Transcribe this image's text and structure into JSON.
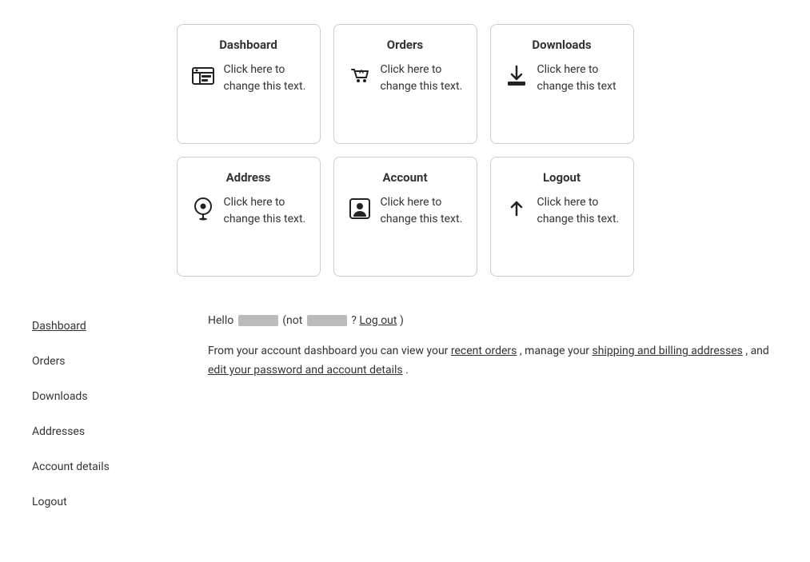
{
  "cards": [
    {
      "id": "dashboard",
      "title": "Dashboard",
      "text": "Click here to change this text.",
      "icon": "dashboard"
    },
    {
      "id": "orders",
      "title": "Orders",
      "text": "Click here to change this text.",
      "icon": "orders"
    },
    {
      "id": "downloads",
      "title": "Downloads",
      "text": "Click here to change this text",
      "icon": "downloads"
    },
    {
      "id": "address",
      "title": "Address",
      "text": "Click here to change this text.",
      "icon": "address"
    },
    {
      "id": "account",
      "title": "Account",
      "text": "Click here to change this text.",
      "icon": "account"
    },
    {
      "id": "logout",
      "title": "Logout",
      "text": "Click here to change this text.",
      "icon": "logout"
    }
  ],
  "sidebar": {
    "items": [
      {
        "label": "Dashboard",
        "active": true
      },
      {
        "label": "Orders",
        "active": false
      },
      {
        "label": "Downloads",
        "active": false
      },
      {
        "label": "Addresses",
        "active": false
      },
      {
        "label": "Account details",
        "active": false
      },
      {
        "label": "Logout",
        "active": false
      }
    ]
  },
  "main": {
    "hello_prefix": "Hello",
    "hello_middle": "(not",
    "hello_suffix": "? ",
    "logout_link": "Log out",
    "logout_close": ")",
    "description_start": "From your account dashboard you can view your ",
    "recent_orders_link": "recent orders",
    "description_mid": ", manage your ",
    "addresses_link": "shipping and billing addresses",
    "description_mid2": ", and ",
    "account_link": "edit your password and account details",
    "description_end": "."
  }
}
